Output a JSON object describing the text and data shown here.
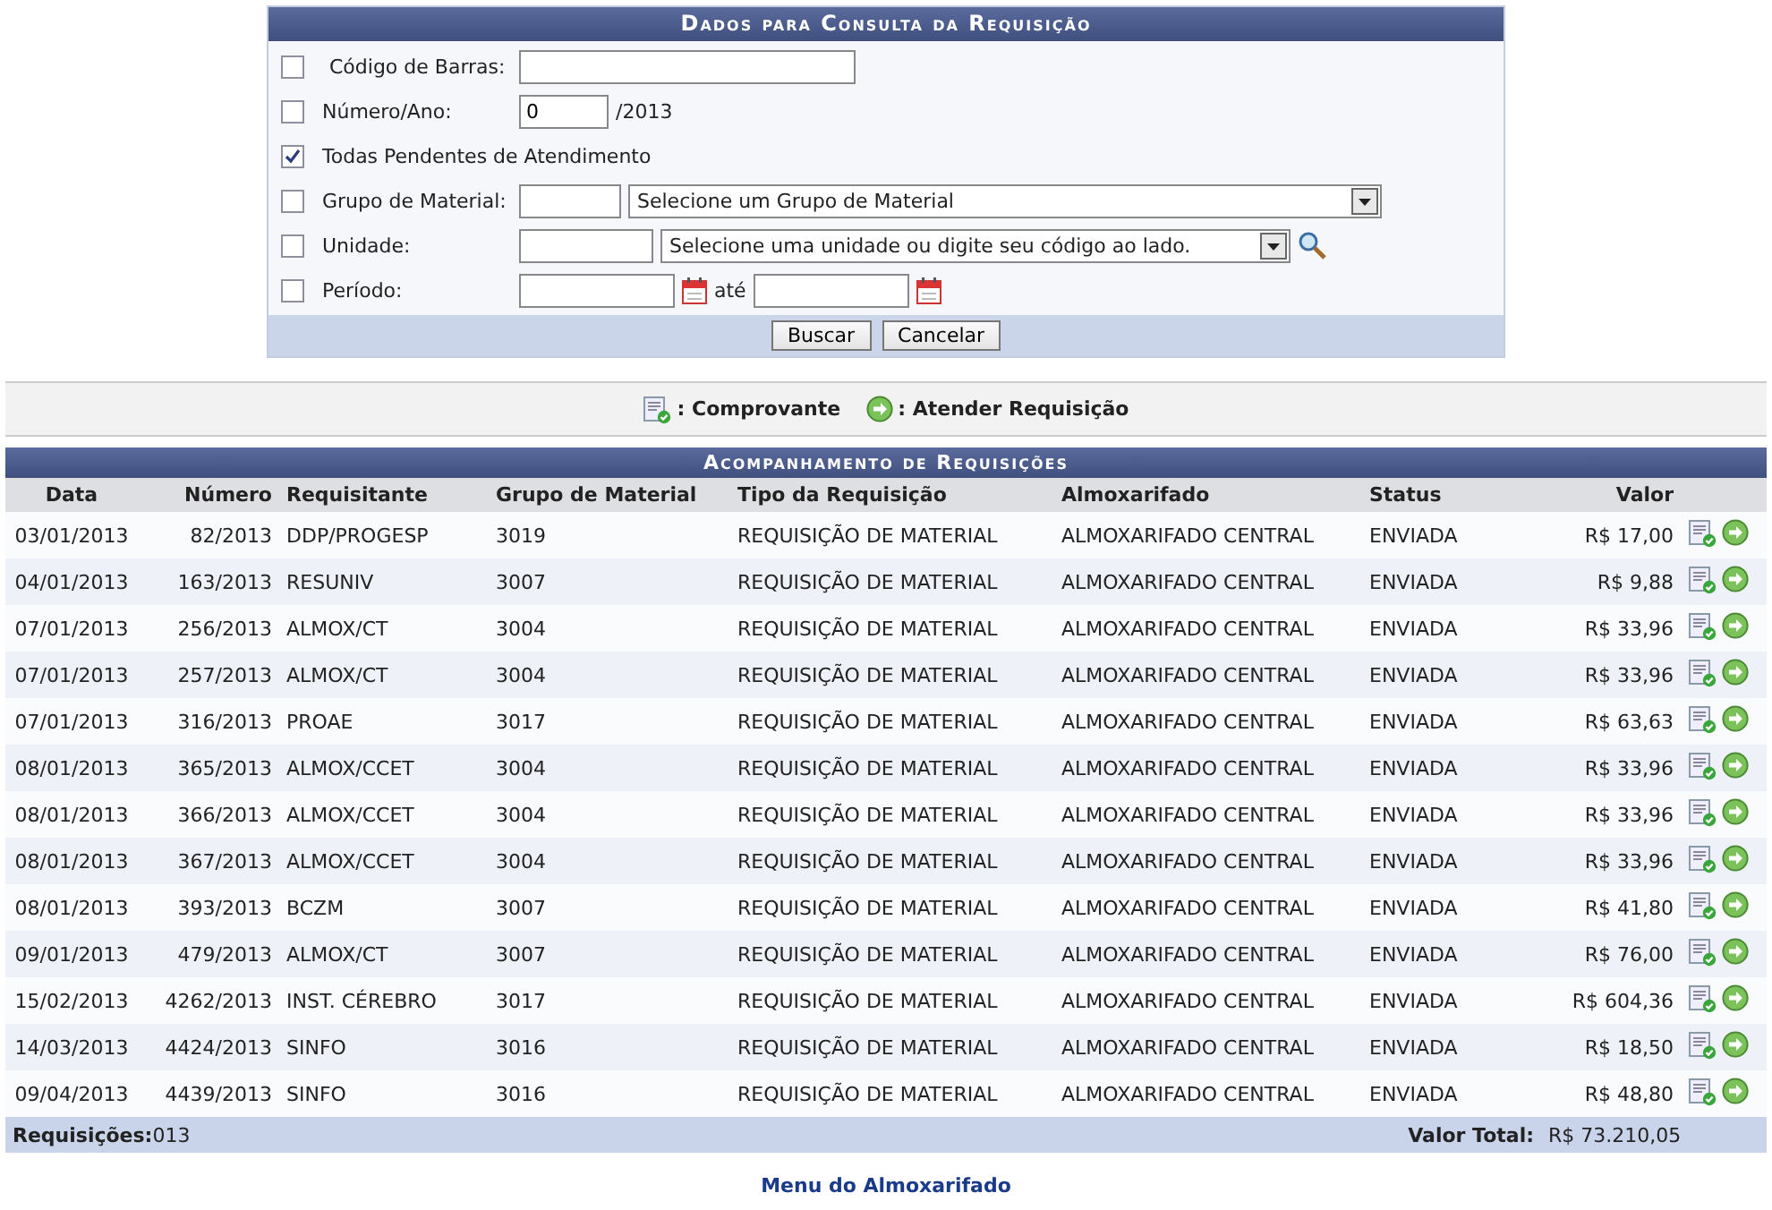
{
  "form": {
    "title": "Dados para Consulta da Requisição",
    "fields": [
      {
        "kind": "text",
        "label": "Código de Barras:",
        "checked": false
      },
      {
        "kind": "number",
        "label": "Número/Ano:",
        "checked": false,
        "value": "0",
        "suffix": "/2013"
      },
      {
        "kind": "flag",
        "label": "Todas Pendentes de Atendimento",
        "checked": true
      },
      {
        "kind": "select",
        "label": "Grupo de Material:",
        "checked": false,
        "option": "Selecione um Grupo de Material"
      },
      {
        "kind": "search",
        "label": "Unidade:",
        "checked": false,
        "option": "Selecione uma unidade ou digite seu código ao lado."
      },
      {
        "kind": "period",
        "label": "Período:",
        "checked": false,
        "between": "até"
      }
    ],
    "buttons": [
      "Buscar",
      "Cancelar"
    ]
  },
  "legend": [
    {
      "kind": "receipt",
      "label": ": Comprovante"
    },
    {
      "kind": "go",
      "label": ": Atender Requisição"
    }
  ],
  "table": {
    "title": "Acompanhamento de Requisições",
    "columns": [
      "Data",
      "Número",
      "Requisitante",
      "Grupo de Material",
      "Tipo da Requisição",
      "Almoxarifado",
      "Status",
      "Valor"
    ],
    "rows": [
      [
        "03/01/2013",
        "82/2013",
        "DDP/PROGESP",
        "3019",
        "REQUISIÇÃO DE MATERIAL",
        "ALMOXARIFADO CENTRAL",
        "ENVIADA",
        "R$ 17,00"
      ],
      [
        "04/01/2013",
        "163/2013",
        "RESUNIV",
        "3007",
        "REQUISIÇÃO DE MATERIAL",
        "ALMOXARIFADO CENTRAL",
        "ENVIADA",
        "R$ 9,88"
      ],
      [
        "07/01/2013",
        "256/2013",
        "ALMOX/CT",
        "3004",
        "REQUISIÇÃO DE MATERIAL",
        "ALMOXARIFADO CENTRAL",
        "ENVIADA",
        "R$ 33,96"
      ],
      [
        "07/01/2013",
        "257/2013",
        "ALMOX/CT",
        "3004",
        "REQUISIÇÃO DE MATERIAL",
        "ALMOXARIFADO CENTRAL",
        "ENVIADA",
        "R$ 33,96"
      ],
      [
        "07/01/2013",
        "316/2013",
        "PROAE",
        "3017",
        "REQUISIÇÃO DE MATERIAL",
        "ALMOXARIFADO CENTRAL",
        "ENVIADA",
        "R$ 63,63"
      ],
      [
        "08/01/2013",
        "365/2013",
        "ALMOX/CCET",
        "3004",
        "REQUISIÇÃO DE MATERIAL",
        "ALMOXARIFADO CENTRAL",
        "ENVIADA",
        "R$ 33,96"
      ],
      [
        "08/01/2013",
        "366/2013",
        "ALMOX/CCET",
        "3004",
        "REQUISIÇÃO DE MATERIAL",
        "ALMOXARIFADO CENTRAL",
        "ENVIADA",
        "R$ 33,96"
      ],
      [
        "08/01/2013",
        "367/2013",
        "ALMOX/CCET",
        "3004",
        "REQUISIÇÃO DE MATERIAL",
        "ALMOXARIFADO CENTRAL",
        "ENVIADA",
        "R$ 33,96"
      ],
      [
        "08/01/2013",
        "393/2013",
        "BCZM",
        "3007",
        "REQUISIÇÃO DE MATERIAL",
        "ALMOXARIFADO CENTRAL",
        "ENVIADA",
        "R$ 41,80"
      ],
      [
        "09/01/2013",
        "479/2013",
        "ALMOX/CT",
        "3007",
        "REQUISIÇÃO DE MATERIAL",
        "ALMOXARIFADO CENTRAL",
        "ENVIADA",
        "R$ 76,00"
      ],
      [
        "15/02/2013",
        "4262/2013",
        "INST. CÉREBRO",
        "3017",
        "REQUISIÇÃO DE MATERIAL",
        "ALMOXARIFADO CENTRAL",
        "ENVIADA",
        "R$ 604,36"
      ],
      [
        "14/03/2013",
        "4424/2013",
        "SINFO",
        "3016",
        "REQUISIÇÃO DE MATERIAL",
        "ALMOXARIFADO CENTRAL",
        "ENVIADA",
        "R$ 18,50"
      ],
      [
        "09/04/2013",
        "4439/2013",
        "SINFO",
        "3016",
        "REQUISIÇÃO DE MATERIAL",
        "ALMOXARIFADO CENTRAL",
        "ENVIADA",
        "R$ 48,80"
      ]
    ],
    "footer": {
      "count_label": "Requisições:",
      "count": "013",
      "total_label": "Valor Total:",
      "total": "R$ 73.210,05"
    }
  },
  "link": "Menu do Almoxarifado"
}
